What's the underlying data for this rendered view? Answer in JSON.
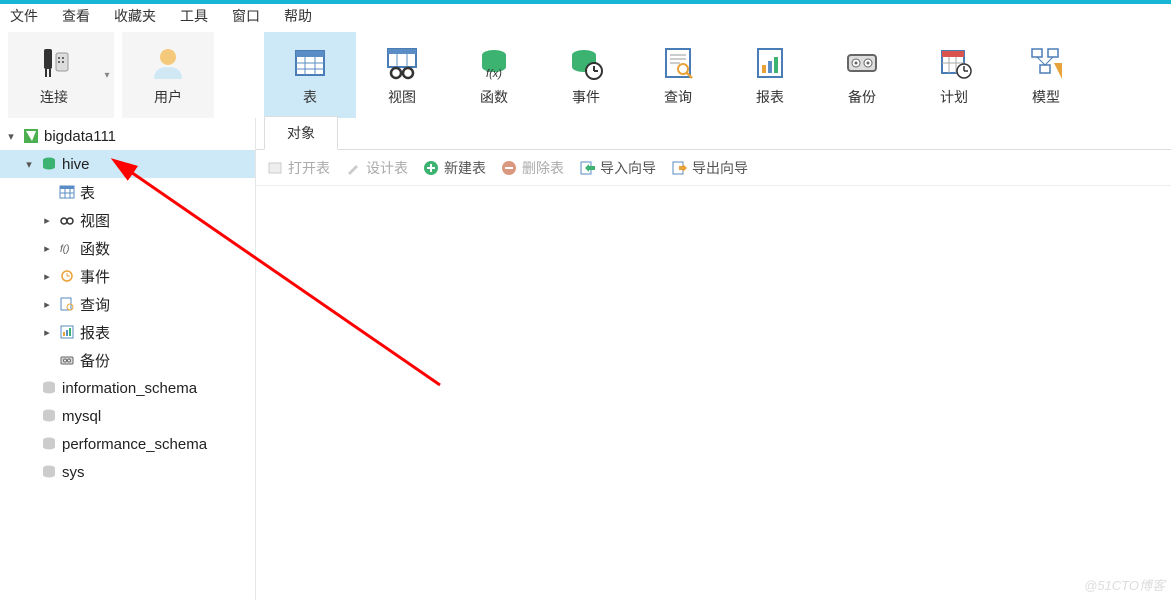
{
  "menu": {
    "file": "文件",
    "view": "查看",
    "favorites": "收藏夹",
    "tools": "工具",
    "window": "窗口",
    "help": "帮助"
  },
  "toolbar": {
    "connect": "连接",
    "user": "用户",
    "table": "表",
    "view": "视图",
    "function": "函数",
    "event": "事件",
    "query": "查询",
    "report": "报表",
    "backup": "备份",
    "schedule": "计划",
    "model": "模型"
  },
  "tree": {
    "connection": "bigdata111",
    "db_hive": "hive",
    "table": "表",
    "view": "视图",
    "function": "函数",
    "event": "事件",
    "query": "查询",
    "report": "报表",
    "backup": "备份",
    "db_info": "information_schema",
    "db_mysql": "mysql",
    "db_perf": "performance_schema",
    "db_sys": "sys"
  },
  "tabs": {
    "objects": "对象"
  },
  "actions": {
    "open_table": "打开表",
    "design_table": "设计表",
    "new_table": "新建表",
    "delete_table": "删除表",
    "import_wizard": "导入向导",
    "export_wizard": "导出向导"
  },
  "watermark": "@51CTO博客"
}
